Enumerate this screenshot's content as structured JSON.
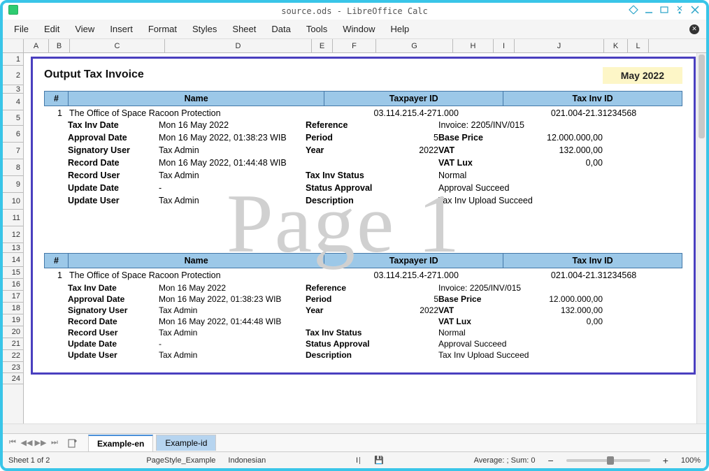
{
  "window": {
    "title": "source.ods - LibreOffice Calc"
  },
  "menu": {
    "file": "File",
    "edit": "Edit",
    "view": "View",
    "insert": "Insert",
    "format": "Format",
    "styles": "Styles",
    "sheet": "Sheet",
    "data": "Data",
    "tools": "Tools",
    "window": "Window",
    "help": "Help"
  },
  "columns": [
    "A",
    "B",
    "C",
    "D",
    "E",
    "F",
    "G",
    "H",
    "I",
    "J",
    "K",
    "L"
  ],
  "rows": [
    "1",
    "2",
    "3",
    "4",
    "5",
    "6",
    "7",
    "8",
    "9",
    "10",
    "11",
    "12",
    "13",
    "14",
    "15",
    "16",
    "17",
    "18",
    "19",
    "20",
    "21",
    "22",
    "23",
    "24"
  ],
  "doc": {
    "title": "Output Tax Invoice",
    "month": "May 2022",
    "head": {
      "num": "#",
      "name": "Name",
      "taxpayer": "Taxpayer ID",
      "invid": "Tax Inv ID"
    },
    "row_num": "1",
    "row_name": "The Office of Space Racoon Protection",
    "row_taxpayer": "03.114.215.4-271.000",
    "row_invid": "021.004-21.31234568",
    "labels": {
      "tax_inv_date": "Tax Inv Date",
      "approval_date": "Approval Date",
      "signatory_user": "Signatory User",
      "record_date": "Record Date",
      "record_user": "Record User",
      "update_date": "Update Date",
      "update_user": "Update User",
      "reference": "Reference",
      "period": "Period",
      "year": "Year",
      "tax_inv_status": "Tax Inv Status",
      "status_approval": "Status Approval",
      "description": "Description",
      "base_price": "Base Price",
      "vat": "VAT",
      "vat_lux": "VAT Lux"
    },
    "values": {
      "tax_inv_date": "Mon 16 May 2022",
      "approval_date": "Mon 16 May 2022, 01:38:23 WIB",
      "signatory_user": "Tax Admin",
      "record_date": "Mon 16 May 2022, 01:44:48 WIB",
      "record_user": "Tax Admin",
      "update_date": "-",
      "update_user": "Tax Admin",
      "reference": "Invoice: 2205/INV/015",
      "period": "5",
      "year": "2022",
      "tax_inv_status": "Normal",
      "status_approval": "Approval Succeed",
      "description": "Tax Inv Upload Succeed",
      "base_price": "12.000.000,00",
      "vat": "132.000,00",
      "vat_lux": "0,00"
    }
  },
  "watermark": "Page 1",
  "tabs": {
    "t1": "Example-en",
    "t2": "Example-id"
  },
  "status": {
    "sheet": "Sheet 1 of 2",
    "pagestyle": "PageStyle_Example",
    "lang": "Indonesian",
    "summary": "Average: ; Sum: 0",
    "zoom": "100%",
    "minus": "−",
    "plus": "+"
  }
}
